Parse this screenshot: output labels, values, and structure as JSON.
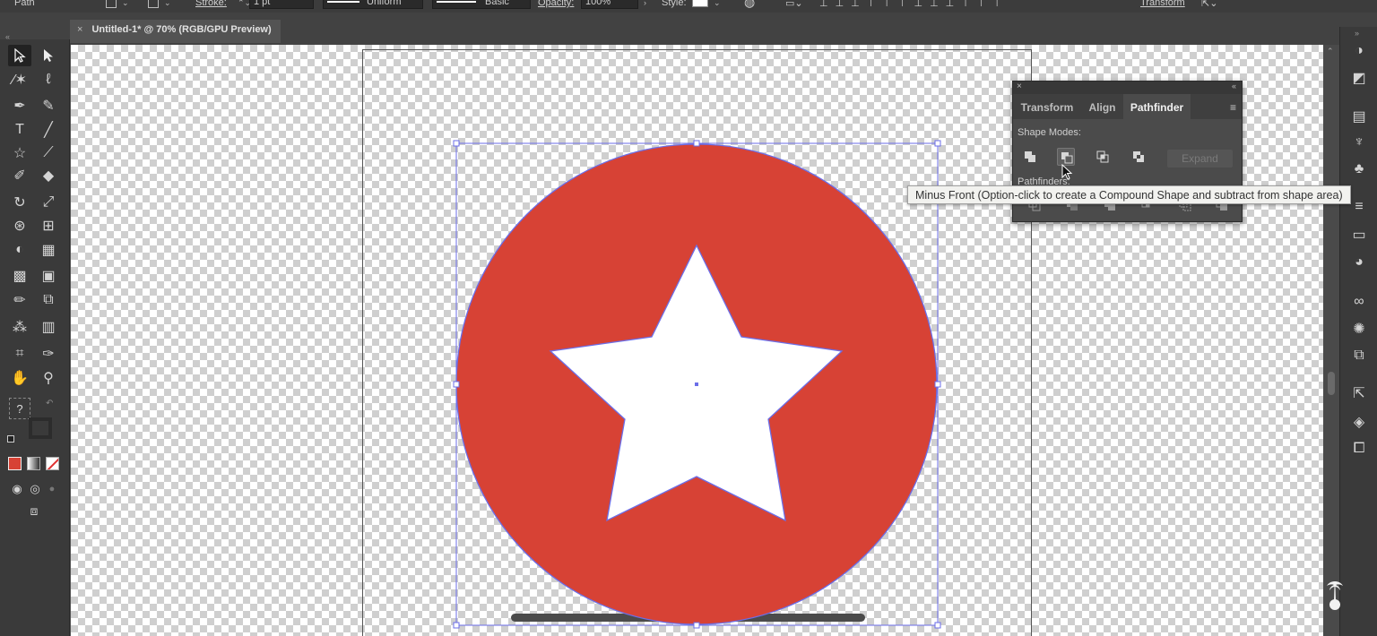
{
  "controlbar": {
    "object_type": "Path",
    "stroke_label": "Stroke:",
    "stroke_weight": "1 pt",
    "profile_value": "Uniform",
    "brush_value": "Basic",
    "opacity_label": "Opacity:",
    "opacity_value": "100%",
    "style_label": "Style:",
    "transform_label": "Transform"
  },
  "document_tab": {
    "close": "×",
    "title": "Untitled-1* @ 70% (RGB/GPU Preview)"
  },
  "toolbar": {
    "tools": [
      "selection",
      "direct-selection",
      "magic-wand",
      "lasso",
      "pen",
      "curvature",
      "type",
      "line-segment",
      "star",
      "paintbrush",
      "shaper",
      "eraser",
      "rotate",
      "scale",
      "warp",
      "free-transform",
      "shape-builder",
      "perspective-grid",
      "mesh",
      "gradient",
      "eyedropper",
      "blend",
      "symbol-sprayer",
      "column-graph",
      "artboard",
      "slice",
      "hand",
      "zoom"
    ],
    "help_glyph": "?",
    "fill_color": "#d74235"
  },
  "pathfinder_panel": {
    "tabs": [
      {
        "label": "Transform",
        "active": false
      },
      {
        "label": "Align",
        "active": false
      },
      {
        "label": "Pathfinder",
        "active": true
      }
    ],
    "shape_modes_label": "Shape Modes:",
    "pathfinders_label": "Pathfinders:",
    "expand_label": "Expand",
    "hovered_button": "minus-front"
  },
  "tooltip": {
    "text": "Minus Front (Option-click to create a Compound Shape and subtract from shape area)"
  },
  "artwork": {
    "circle_color": "#d74235",
    "star_color": "#ffffff",
    "selection_color": "#6b6ee8"
  }
}
